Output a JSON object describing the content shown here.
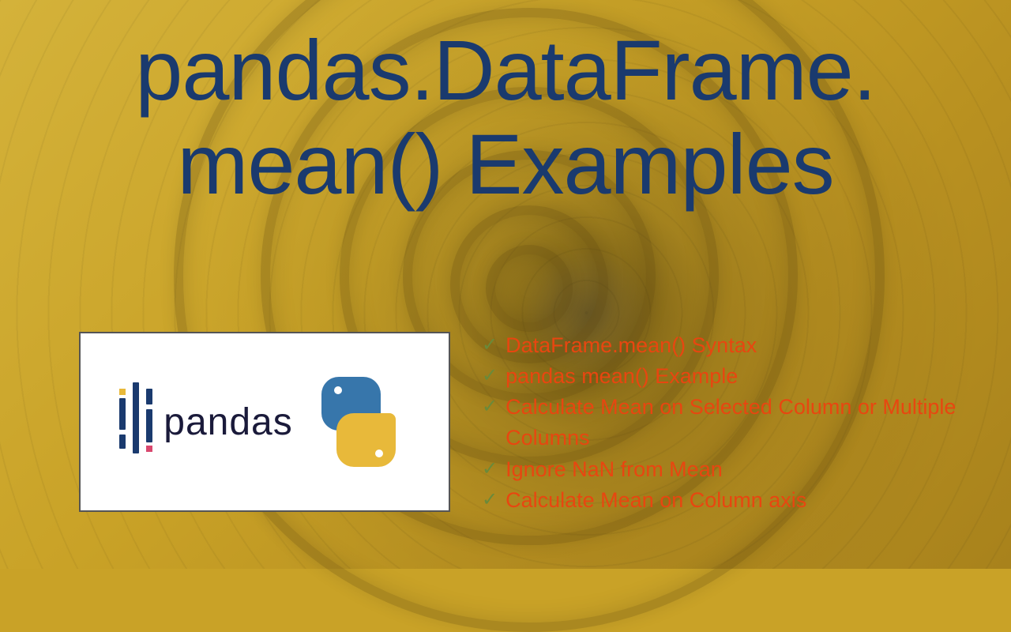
{
  "title_line1": "pandas.DataFrame.",
  "title_line2": "mean() Examples",
  "logo": {
    "pandas_text": "pandas"
  },
  "bullets": [
    "DataFrame.mean() Syntax",
    "pandas mean() Example",
    "Calculate Mean on Selected Column or Multiple Columns",
    "Ignore NaN from Mean",
    "Calculate Mean on Column axis"
  ],
  "colors": {
    "title": "#1a3a6e",
    "bullet_text": "#e84610",
    "check": "#6a8a3a",
    "bg_primary": "#c9a227"
  }
}
